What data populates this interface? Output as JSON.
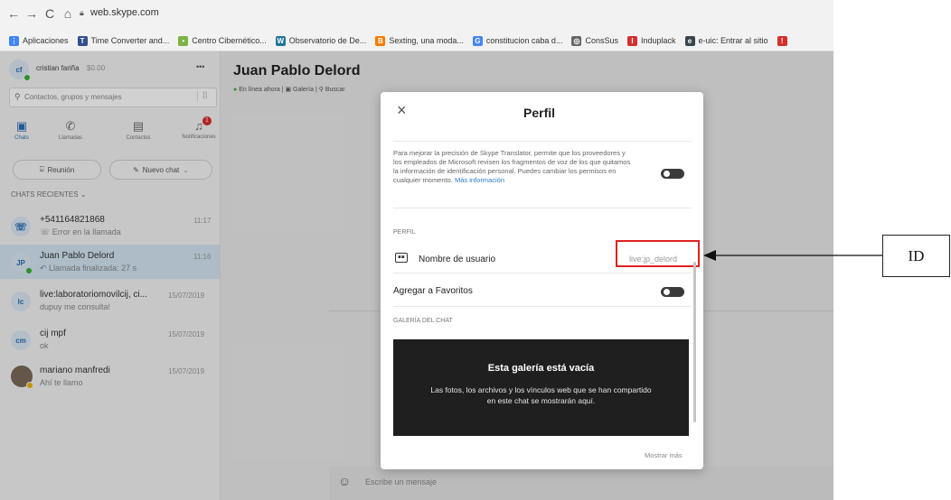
{
  "browser": {
    "url": "web.skype.com",
    "bookmarks": [
      {
        "label": "Aplicaciones",
        "icon": "apps-grid-icon",
        "color": "#4285f4",
        "glyph": "⋮"
      },
      {
        "label": "Time Converter and...",
        "icon": "time-converter-icon",
        "color": "#2f4f8f",
        "glyph": "T"
      },
      {
        "label": "Centro Cibernético...",
        "icon": "centro-cibernetico-icon",
        "color": "#7cb342",
        "glyph": "•"
      },
      {
        "label": "Observatorio de De...",
        "icon": "wordpress-icon",
        "color": "#21759b",
        "glyph": "W"
      },
      {
        "label": "Sexting, una moda...",
        "icon": "blogger-icon",
        "color": "#f57c00",
        "glyph": "B"
      },
      {
        "label": "constitucion caba d...",
        "icon": "google-icon",
        "color": "#4285f4",
        "glyph": "G"
      },
      {
        "label": "ConsSus",
        "icon": "globe-icon",
        "color": "#666666",
        "glyph": "◎"
      },
      {
        "label": "Induplack",
        "icon": "induplack-icon",
        "color": "#d32f2f",
        "glyph": "I"
      },
      {
        "label": "e-uic: Entrar al sitio",
        "icon": "euic-icon",
        "color": "#37474f",
        "glyph": "e"
      },
      {
        "label": "",
        "icon": "red-bookmark-icon",
        "color": "#d32f2f",
        "glyph": "!"
      }
    ]
  },
  "sidebar": {
    "profile_initials": "cf",
    "profile_name": "cristian fariña",
    "profile_credit": "$0.00",
    "more": "•••",
    "search_placeholder": "Contactos, grupos y mensajes",
    "nav": [
      {
        "label": "Chats",
        "glyph": "▣"
      },
      {
        "label": "Llamadas",
        "glyph": "✆"
      },
      {
        "label": "Contactos",
        "glyph": "▤"
      },
      {
        "label": "Notificaciones",
        "glyph": "♫",
        "badge": "1"
      }
    ],
    "meeting_button": "Reunión",
    "new_chat_button": "Nuevo chat",
    "recent_header": "CHATS RECIENTES",
    "chats": [
      {
        "initials": "☏",
        "name": "+541164821868",
        "preview": "Error en la llamada",
        "time": "11:17"
      },
      {
        "initials": "JP",
        "name": "Juan Pablo Delord",
        "preview": "Llamada finalizada: 27 s",
        "time": "11:16"
      },
      {
        "initials": "lc",
        "name": "live:laboratoriomovilcij, ci...",
        "preview": "dupuy me consulta!",
        "time": "15/07/2019"
      },
      {
        "initials": "cm",
        "name": "cij mpf",
        "preview": "ok",
        "time": "15/07/2019"
      },
      {
        "initials": "",
        "name": "mariano manfredi",
        "preview": "Ahí te llamo",
        "time": "15/07/2019"
      }
    ]
  },
  "conversation": {
    "title": "Juan Pablo Delord",
    "status": "En línea ahora",
    "gallery_link": "Galería",
    "search_link": "Buscar",
    "message_placeholder": "Escribe un mensaje"
  },
  "profile_modal": {
    "title": "Perfil",
    "translator_text": "Para mejorar la precisión de Skype Translator, permite que los proveedores y los empleados de Microsoft revisen los fragmentos de voz de los que quitamos la información de identificación personal. Puedes cambiar los permisos en cualquier momento.",
    "more_info_link": "Más información",
    "section_profile": "PERFIL",
    "username_label": "Nombre de usuario",
    "username_value": "live:jp_delord",
    "favorites_label": "Agregar a Favoritos",
    "section_gallery": "GALERÍA DEL CHAT",
    "gallery_empty_title": "Esta galería está vacía",
    "gallery_empty_text": "Las fotos, los archivos y los vínculos web que se han compartido en este chat se mostrarán aquí.",
    "show_more": "Mostrar más"
  },
  "annotation": {
    "label": "ID",
    "highlight_color": "#e02020"
  }
}
